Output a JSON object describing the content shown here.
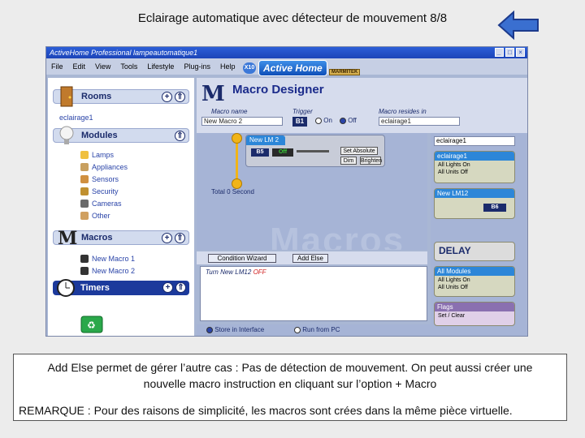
{
  "slide": {
    "title": "Eclairage automatique avec détecteur de mouvement 8/8"
  },
  "app": {
    "window_title": "ActiveHome Professional lampeautomatique1",
    "menu": [
      "File",
      "Edit",
      "View",
      "Tools",
      "Lifestyle",
      "Plug-ins",
      "Help"
    ],
    "logo_text": "Active Home",
    "logo_badge": "X10",
    "brand": "MARMITEK"
  },
  "sidebar": {
    "rooms": {
      "label": "Rooms",
      "items": [
        "eclairage1"
      ]
    },
    "modules": {
      "label": "Modules",
      "items": [
        "Lamps",
        "Appliances",
        "Sensors",
        "Security",
        "Cameras",
        "Other"
      ]
    },
    "macros": {
      "label": "Macros",
      "items": [
        "New Macro 1",
        "New Macro 2"
      ]
    },
    "timers": {
      "label": "Timers"
    }
  },
  "macro_designer": {
    "title": "Macro Designer",
    "macro_name_label": "Macro name",
    "macro_name_value": "New Macro 2",
    "trigger_label": "Trigger",
    "trigger_value": "B1",
    "on_label": "On",
    "off_label": "Off",
    "macro_resides_label": "Macro resides in",
    "macro_resides_value": "eclairage1",
    "timeline_card": {
      "title": "New LM 2",
      "address": "B5",
      "state": "Off",
      "set_absolute": "Set Absolute",
      "dim": "Dim",
      "brighten": "Brighten"
    },
    "total": "Total 0 Second",
    "watermark": "Macros",
    "condition_wizard": "Condition Wizard",
    "add_else": "Add Else",
    "condition_text": "Turn New LM12",
    "condition_state": "OFF",
    "store_interface": "Store in Interface",
    "run_pc": "Run from PC"
  },
  "right_panel": {
    "select_value": "eclairage1",
    "room_card": {
      "title": "eclairage1",
      "line1": "All Lights On",
      "line2": "All Units Off"
    },
    "module_card": {
      "title": "New LM12",
      "address": "B6"
    },
    "delay": "DELAY",
    "all_modules": {
      "title": "All Modules",
      "line1": "All Lights On",
      "line2": "All Units Off"
    },
    "flags": {
      "title": "Flags",
      "line1": "Set / Clear"
    }
  },
  "caption": {
    "line1": "Add Else permet de gérer l’autre cas : Pas de détection de mouvement. On peut aussi créer une nouvelle macro instruction en cliquant sur l’option + Macro",
    "line2": "REMARQUE : Pour des raisons de simplicité, les macros sont crées dans la même pièce virtuelle."
  },
  "colors": {
    "accent": "#1c3a9c",
    "timeline": "#f1b418",
    "panel": "#a6b4d6"
  }
}
